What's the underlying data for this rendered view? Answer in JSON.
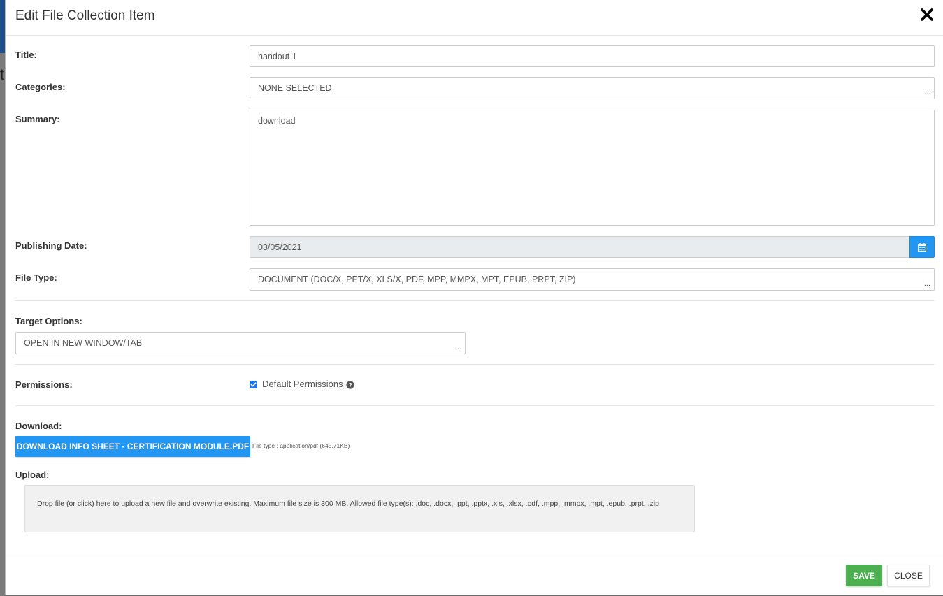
{
  "modal": {
    "title": "Edit File Collection Item",
    "close_icon": "close-icon"
  },
  "form": {
    "title_label": "Title:",
    "title_value": "handout 1",
    "categories_label": "Categories:",
    "categories_value": "NONE SELECTED",
    "categories_more": "...",
    "summary_label": "Summary:",
    "summary_value": "download",
    "publishing_date_label": "Publishing Date:",
    "publishing_date_value": "03/05/2021",
    "calendar_icon": "calendar-icon",
    "file_type_label": "File Type:",
    "file_type_value": "DOCUMENT (DOC/X, PPT/X, XLS/X, PDF, MPP, MMPX, MPT, EPUB, PRPT, ZIP)",
    "file_type_more": "...",
    "target_options_label": "Target Options:",
    "target_options_value": "OPEN IN NEW WINDOW/TAB",
    "target_options_more": "...",
    "permissions_label": "Permissions:",
    "default_permissions_label": "Default Permissions",
    "default_permissions_checked": true,
    "help_icon": "question-circle-icon",
    "download_label": "Download:",
    "download_button": "DOWNLOAD INFO SHEET - CERTIFICATION MODULE.PDF",
    "file_info": "File type : application/pdf (645.71KB)",
    "upload_label": "Upload:",
    "upload_dropzone_text": "Drop file (or click) here to upload a new file and overwrite existing. Maximum file size is 300 MB. Allowed file type(s): .doc, .docx, .ppt, .pptx, .xls, .xlsx, .pdf, .mpp, .mmpx, .mpt, .epub, .prpt, .zip"
  },
  "footer": {
    "save_label": "SAVE",
    "close_label": "CLOSE"
  },
  "colors": {
    "primary": "#2196f3",
    "success": "#4caf50",
    "disabled_field": "#e9ecef"
  }
}
